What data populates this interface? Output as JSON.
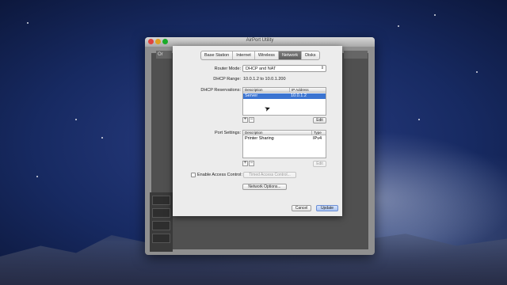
{
  "window": {
    "title": "AirPort Utility",
    "side_label": "Or"
  },
  "tabs": [
    "Base Station",
    "Internet",
    "Wireless",
    "Network",
    "Disks"
  ],
  "active_tab": "Network",
  "router_mode": {
    "label": "Router Mode:",
    "value": "DHCP and NAT"
  },
  "dhcp_range": {
    "label": "DHCP Range:",
    "value": "10.0.1.2 to 10.0.1.200"
  },
  "dhcp_reservations": {
    "label": "DHCP Reservations:",
    "columns": [
      "Description",
      "IP Address"
    ],
    "rows": [
      {
        "description": "Server",
        "ip": "10.0.1.2",
        "selected": true
      }
    ],
    "add_label": "+",
    "remove_label": "−",
    "edit_label": "Edit"
  },
  "port_settings": {
    "label": "Port Settings:",
    "columns": [
      "Description",
      "Type"
    ],
    "rows": [
      {
        "description": "Printer Sharing",
        "type": "IPv4"
      }
    ],
    "add_label": "+",
    "remove_label": "−",
    "edit_label": "Edit"
  },
  "access_control": {
    "checkbox_label": "Enable Access Control:",
    "timed_button": "Timed Access Control..."
  },
  "network_options_button": "Network Options...",
  "footer": {
    "cancel": "Cancel",
    "update": "Update"
  },
  "colors": {
    "selection": "#3b74d1",
    "sheet": "#ececec"
  }
}
